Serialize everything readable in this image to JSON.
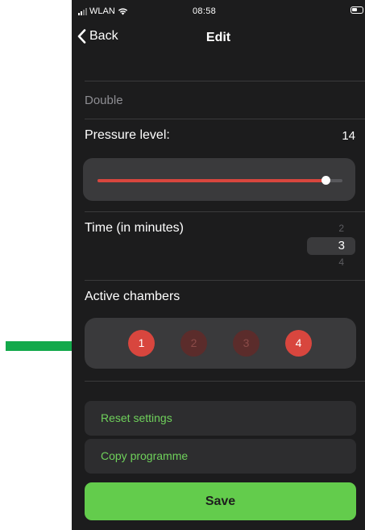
{
  "status_bar": {
    "carrier": "WLAN",
    "time": "08:58"
  },
  "nav": {
    "back_label": "Back",
    "title": "Edit"
  },
  "programme": {
    "name": "Double"
  },
  "pressure": {
    "label": "Pressure level:",
    "value": "14",
    "slider_fraction": 0.93
  },
  "time": {
    "label": "Time (in minutes)",
    "options": [
      "2",
      "3",
      "4"
    ],
    "selected": "3"
  },
  "chambers": {
    "label": "Active chambers",
    "items": [
      {
        "number": "1",
        "active": true
      },
      {
        "number": "2",
        "active": false
      },
      {
        "number": "3",
        "active": false
      },
      {
        "number": "4",
        "active": true
      }
    ]
  },
  "actions": {
    "reset_label": "Reset settings",
    "copy_label": "Copy programme",
    "save_label": "Save"
  },
  "colors": {
    "accent_red": "#d8463e",
    "accent_green": "#63cc4c",
    "link_green": "#6fd15b",
    "arrow_green": "#13a94b"
  }
}
